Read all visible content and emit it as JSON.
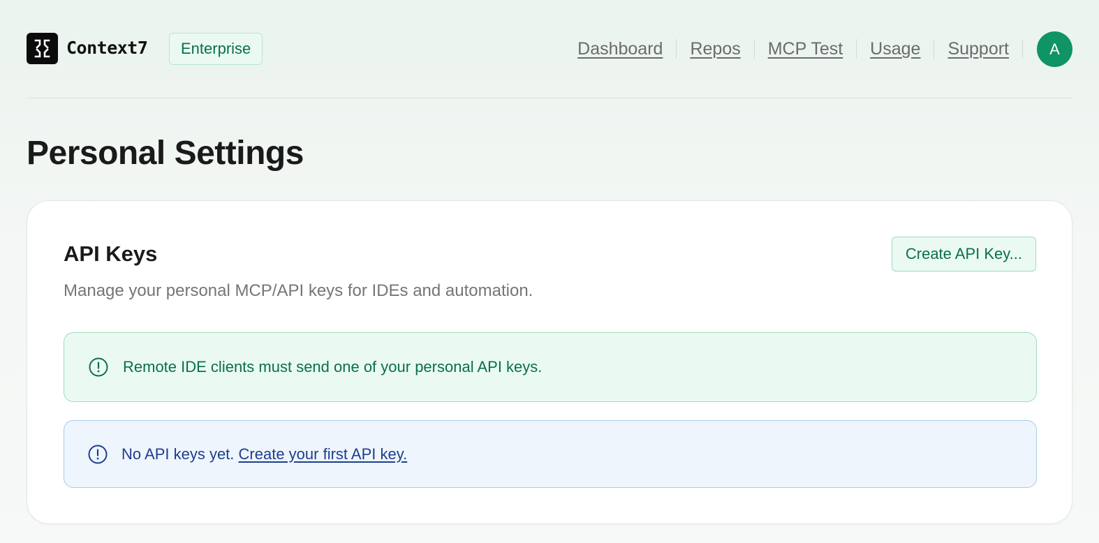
{
  "header": {
    "brand": "Context7",
    "plan_badge": "Enterprise",
    "nav": [
      {
        "label": "Dashboard"
      },
      {
        "label": "Repos"
      },
      {
        "label": "MCP Test"
      },
      {
        "label": "Usage"
      },
      {
        "label": "Support"
      }
    ],
    "avatar_initial": "A",
    "avatar_color": "#0f9463"
  },
  "page": {
    "title": "Personal Settings"
  },
  "api_keys": {
    "title": "API Keys",
    "description": "Manage your personal MCP/API keys for IDEs and automation.",
    "create_button": "Create API Key...",
    "notice": "Remote IDE clients must send one of your personal API keys.",
    "empty_text": "No API keys yet.",
    "empty_link": "Create your first API key."
  },
  "icons": {
    "logo": "context7-logo-icon",
    "notice": "alert-circle-icon",
    "empty": "alert-circle-icon"
  },
  "colors": {
    "accent_green": "#0b6e4f",
    "info_blue": "#1e3d8f"
  }
}
